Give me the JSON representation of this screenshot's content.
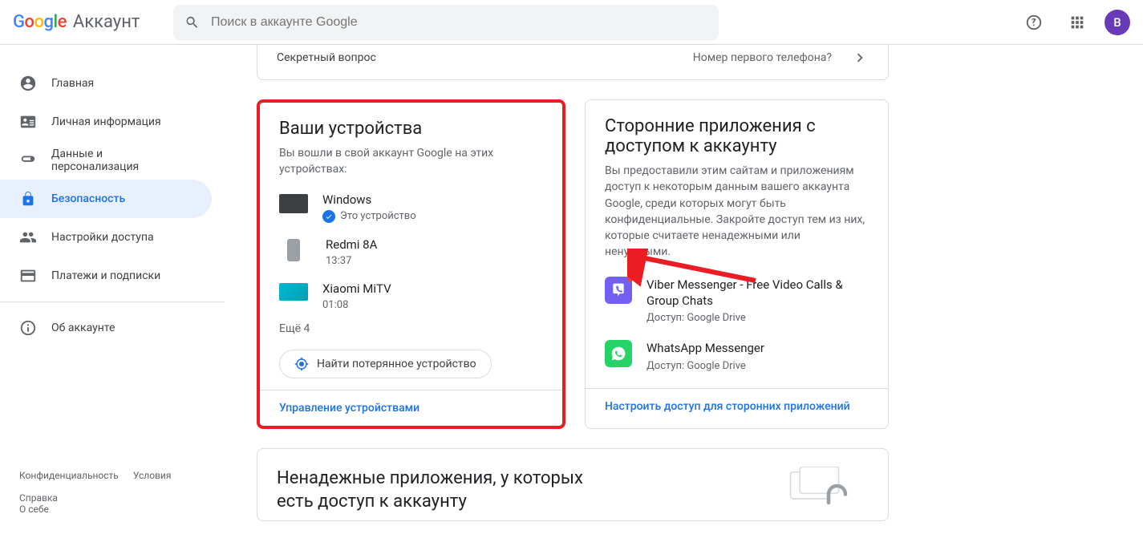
{
  "header": {
    "brand": "Аккаунт",
    "search_placeholder": "Поиск в аккаунте Google",
    "avatar_letter": "B"
  },
  "sidebar": {
    "items": [
      {
        "id": "home",
        "label": "Главная"
      },
      {
        "id": "personal",
        "label": "Личная информация"
      },
      {
        "id": "data",
        "label": "Данные и персонализация"
      },
      {
        "id": "security",
        "label": "Безопасность"
      },
      {
        "id": "sharing",
        "label": "Настройки доступа"
      },
      {
        "id": "payments",
        "label": "Платежи и подписки"
      },
      {
        "id": "about",
        "label": "Об аккаунте"
      }
    ],
    "footer": {
      "privacy": "Конфиденциальность",
      "terms": "Условия",
      "help": "Справка",
      "about": "О себе"
    }
  },
  "secret_row": {
    "label": "Секретный вопрос",
    "value": "Номер первого телефона?"
  },
  "devices_card": {
    "title": "Ваши устройства",
    "subtitle": "Вы вошли в свой аккаунт Google на этих устройствах:",
    "this_device_label": "Это устройство",
    "list": [
      {
        "name": "Windows",
        "meta": "Это устройство",
        "kind": "desktop",
        "is_current": true
      },
      {
        "name": "Redmi 8A",
        "meta": "13:37",
        "kind": "phone",
        "is_current": false
      },
      {
        "name": "Xiaomi MiTV",
        "meta": "01:08",
        "kind": "tv",
        "is_current": false
      }
    ],
    "more": "Ещё 4",
    "find_button": "Найти потерянное устройство",
    "manage_link": "Управление устройствами"
  },
  "apps_card": {
    "title": "Сторонние приложения с доступом к аккаунту",
    "subtitle": "Вы предоставили этим сайтам и приложениям доступ к некоторым данным вашего аккаунта Google, среди которых могут быть конфиденциальные. Закройте доступ тем из них, которые считаете ненадежными или ненужными.",
    "list": [
      {
        "name": "Viber Messenger - Free Video Calls & Group Chats",
        "meta": "Доступ: Google Drive",
        "icon": "viber"
      },
      {
        "name": "WhatsApp Messenger",
        "meta": "Доступ: Google Drive",
        "icon": "whatsapp"
      }
    ],
    "manage_link": "Настроить доступ для сторонних приложений"
  },
  "lessecure_card": {
    "title": "Ненадежные приложения, у которых есть доступ к аккаунту"
  }
}
